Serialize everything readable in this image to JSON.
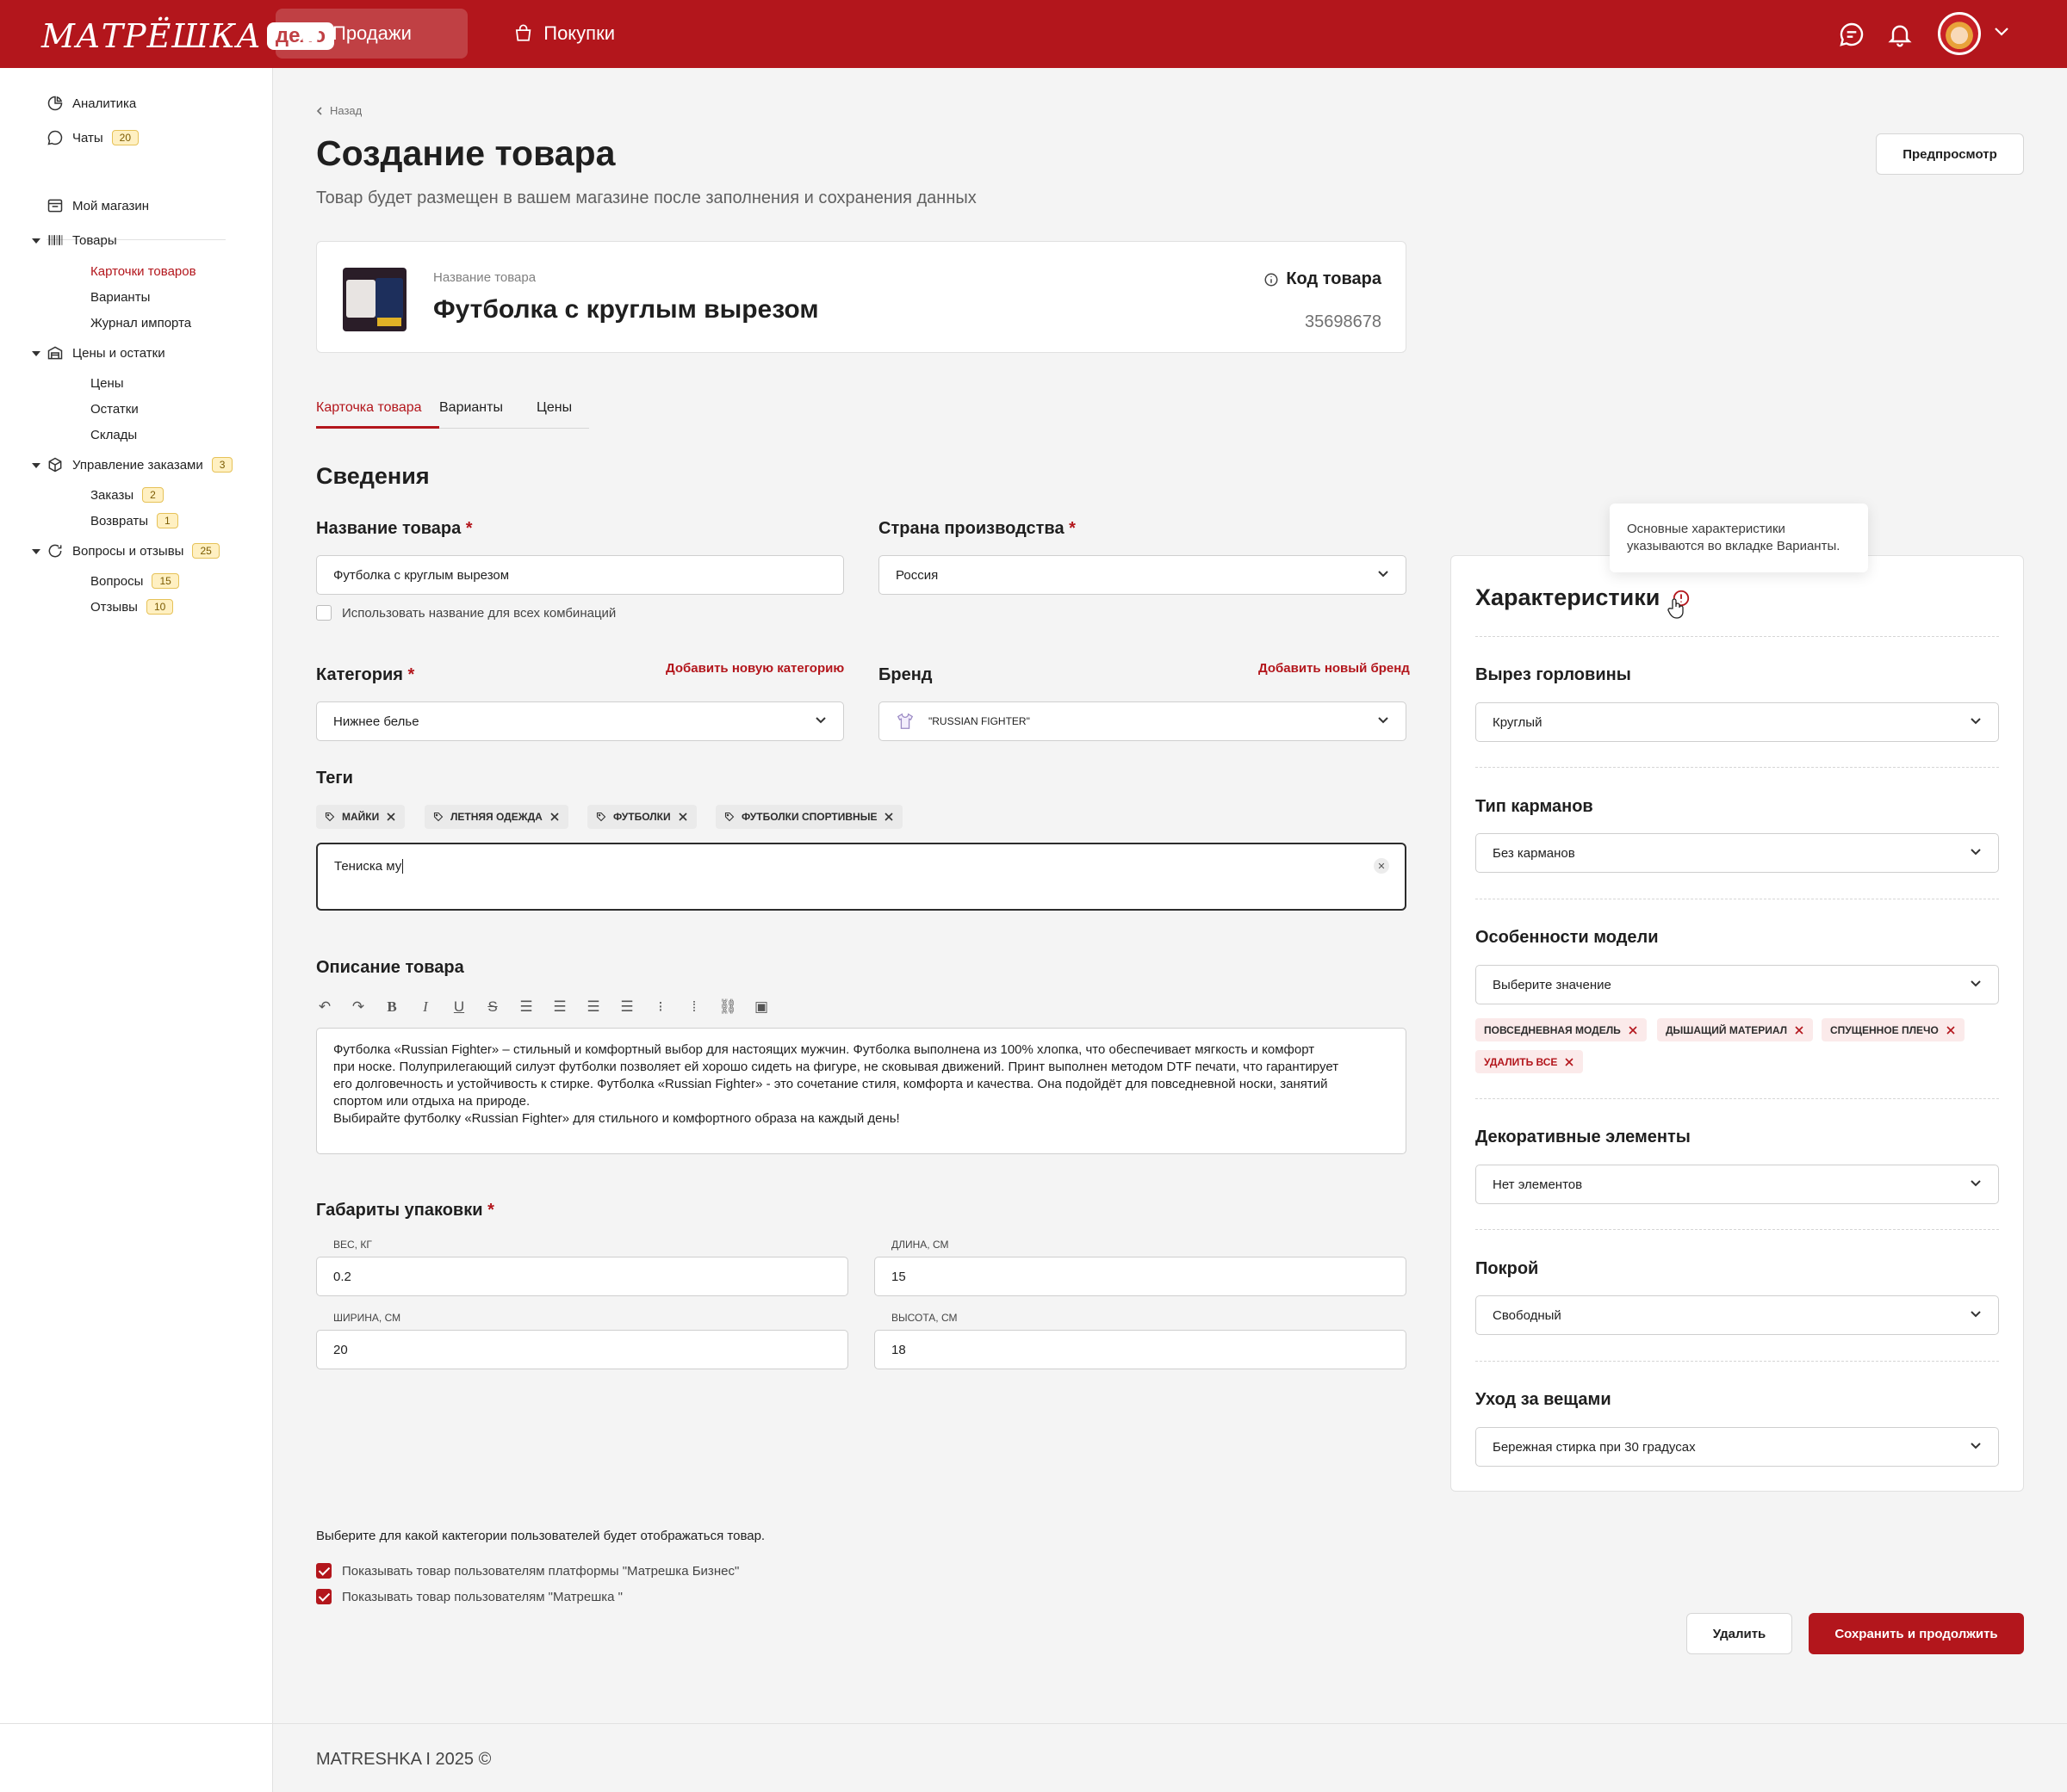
{
  "header": {
    "logo_text": "МАТРЁШКА",
    "logo_badge": "дело",
    "tabs": [
      {
        "label": "Продажи",
        "active": true
      },
      {
        "label": "Покупки",
        "active": false
      }
    ]
  },
  "sidebar": {
    "analytics": "Аналитика",
    "chats": "Чаты",
    "chats_badge": "20",
    "my_store": "Мой магазин",
    "goods": "Товары",
    "goods_sub": [
      "Карточки товаров",
      "Варианты",
      "Журнал импорта"
    ],
    "prices": "Цены и остатки",
    "prices_sub": [
      "Цены",
      "Остатки",
      "Склады"
    ],
    "orders": "Управление заказами",
    "orders_badge": "3",
    "orders_sub": [
      {
        "label": "Заказы",
        "badge": "2"
      },
      {
        "label": "Возвраты",
        "badge": "1"
      }
    ],
    "qa": "Вопросы и отзывы",
    "qa_badge": "25",
    "qa_sub": [
      {
        "label": "Вопросы",
        "badge": "15"
      },
      {
        "label": "Отзывы",
        "badge": "10"
      }
    ]
  },
  "page": {
    "back": "Назад",
    "title": "Создание товара",
    "subtitle": "Товар будет размещен в вашем магазине после заполнения и сохранения данных",
    "preview_button": "Предпросмотр"
  },
  "product": {
    "name_label": "Название товара",
    "name": "Футболка с круглым вырезом",
    "code_label": "Код товара",
    "code": "35698678"
  },
  "tabs": [
    "Карточка товара",
    "Варианты",
    "Цены"
  ],
  "form": {
    "section": "Сведения",
    "name_label": "Название товара",
    "name_value": "Футболка с круглым вырезом",
    "use_name_all": "Использовать название для всех комбинаций",
    "country_label": "Страна производства",
    "country_value": "Россия",
    "category_label": "Категория",
    "category_add": "Добавить новую категорию",
    "category_value": "Нижнее белье",
    "brand_label": "Бренд",
    "brand_add": "Добавить новый бренд",
    "brand_value": "\"RUSSIAN FIGHTER\"",
    "tags_label": "Теги",
    "tags": [
      "Майки",
      "Летняя одежда",
      "Футболки",
      "Футболки спортивные"
    ],
    "tag_input": "Тениска му",
    "desc_label": "Описание товара",
    "description": "Футболка «Russian Fighter» – стильный и комфортный выбор для настоящих мужчин. Футболка выполнена из 100% хлопка, что обеспечивает мягкость и комфорт\nпри носке. Полуприлегающий силуэт футболки позволяет ей хорошо сидеть на фигуре, не сковывая движений. Принт выполнен методом DTF печати, что гарантирует\nего долговечность и устойчивость к стирке. Футболка «Russian Fighter» - это сочетание стиля, комфорта и качества. Она подойдёт для повседневной носки, занятий\nспортом или отдыха на природе.\nВыбирайте футболку «Russian Fighter» для стильного и комфортного образа на каждый день!",
    "dims_label": "Габариты упаковки",
    "weight_label": "вес, кг",
    "weight": "0.2",
    "length_label": "длина, см",
    "length": "15",
    "width_label": "ширина, см",
    "width": "20",
    "height_label": "высота, см",
    "height": "18",
    "visibility_title": "Выберите для какой кактегории пользователей будет отображаться товар.",
    "vis_business": "Показывать товар пользователям платформы \"Матрешка Бизнес\"",
    "vis_matreshka": "Показывать товар пользователям \"Матрешка \"",
    "delete_button": "Удалить",
    "save_button": "Сохранить и продолжить"
  },
  "characteristics": {
    "title": "Характеристики",
    "tooltip": "Основные характеристики указываются во вкладке Варианты.",
    "fields": [
      {
        "label": "Вырез горловины",
        "value": "Круглый"
      },
      {
        "label": "Тип карманов",
        "value": "Без карманов"
      },
      {
        "label": "Особенности модели",
        "value": "Выберите значение"
      },
      {
        "label": "Декоративные элементы",
        "value": "Нет элементов"
      },
      {
        "label": "Покрой",
        "value": "Свободный"
      },
      {
        "label": "Уход за вещами",
        "value": "Бережная стирка при 30 градусах"
      }
    ],
    "model_tags": [
      "Повседневная модель",
      "Дышащий материал",
      "Спущенное плечо"
    ],
    "remove_all": "Удалить все"
  },
  "footer": {
    "text": "MATRESHKA I 2025 ©"
  },
  "colors": {
    "brand": "#b3161c",
    "background": "#f4f4f4",
    "badge": "#fff0c2"
  }
}
